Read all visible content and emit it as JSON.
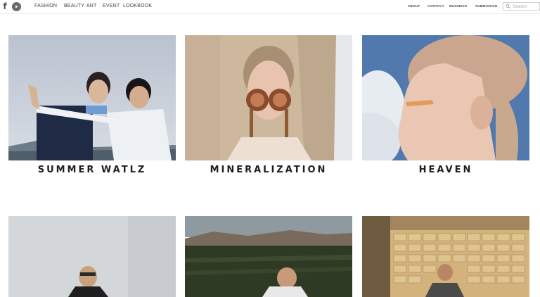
{
  "nav": {
    "fashion": "FASHION",
    "beauty": "BEAUTY",
    "art": "ART",
    "event": "EVENT",
    "lookbook": "LOOKBOOK"
  },
  "secondary_nav": {
    "about": "ABOUT",
    "contact": "CONTACT",
    "business": "BUSINESS",
    "submission": "SUBMISSION"
  },
  "social": {
    "facebook_glyph": "f",
    "icons": [
      "facebook-icon",
      "play-icon"
    ]
  },
  "search": {
    "placeholder": "Search"
  },
  "articles": [
    {
      "title": "SUMMER WATLZ"
    },
    {
      "title": "MINERALIZATION"
    },
    {
      "title": "HEAVEN"
    },
    {
      "title": ""
    },
    {
      "title": ""
    },
    {
      "title": ""
    }
  ],
  "colors": {
    "title": "#1e1e1e",
    "nav_text": "#444444",
    "border": "#ececec"
  }
}
